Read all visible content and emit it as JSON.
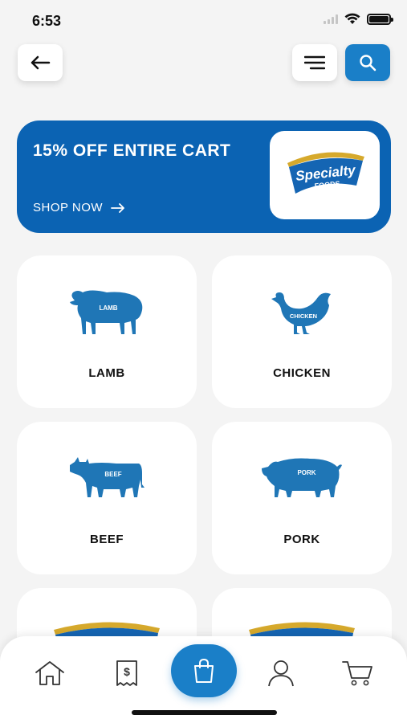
{
  "status": {
    "time": "6:53"
  },
  "banner": {
    "title": "15% OFF ENTIRE CART",
    "cta": "SHOP NOW",
    "logo_text": "Specialty",
    "logo_subtext": "FOODS"
  },
  "categories": [
    {
      "label": "LAMB",
      "icon_text": "LAMB"
    },
    {
      "label": "CHICKEN",
      "icon_text": "CHICKEN"
    },
    {
      "label": "BEEF",
      "icon_text": "BEEF"
    },
    {
      "label": "PORK",
      "icon_text": "PORK"
    }
  ],
  "colors": {
    "accent": "#1a7fc8",
    "banner": "#0b63b3",
    "animal": "#1f76b6"
  },
  "nav_icons": [
    "home-icon",
    "receipt-icon",
    "shopping-bag-icon",
    "profile-icon",
    "cart-icon"
  ]
}
